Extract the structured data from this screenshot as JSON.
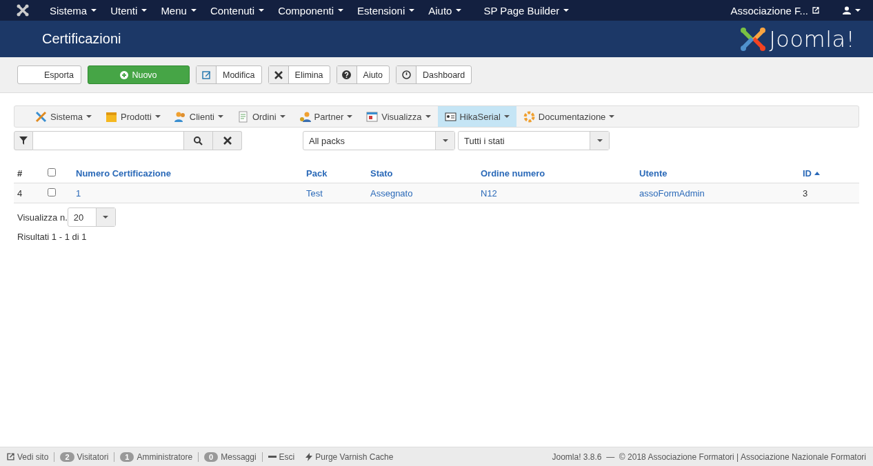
{
  "top_menu": {
    "items": [
      {
        "label": "Sistema"
      },
      {
        "label": "Utenti"
      },
      {
        "label": "Menu"
      },
      {
        "label": "Contenuti"
      },
      {
        "label": "Componenti"
      },
      {
        "label": "Estensioni"
      },
      {
        "label": "Aiuto"
      },
      {
        "label": "SP Page Builder"
      }
    ],
    "site_link": "Associazione F..."
  },
  "header": {
    "title": "Certificazioni",
    "logo_text": "Joomla!"
  },
  "toolbar": {
    "buttons": [
      {
        "label": "Esporta",
        "kind": "export"
      },
      {
        "label": "Nuovo",
        "kind": "new"
      },
      {
        "label": "Modifica",
        "kind": "edit"
      },
      {
        "label": "Elimina",
        "kind": "delete"
      },
      {
        "label": "Aiuto",
        "kind": "help"
      },
      {
        "label": "Dashboard",
        "kind": "dashboard"
      }
    ]
  },
  "submenu": {
    "items": [
      {
        "label": "Sistema",
        "selected": false
      },
      {
        "label": "Prodotti",
        "selected": false
      },
      {
        "label": "Clienti",
        "selected": false
      },
      {
        "label": "Ordini",
        "selected": false
      },
      {
        "label": "Partner",
        "selected": false
      },
      {
        "label": "Visualizza",
        "selected": false
      },
      {
        "label": "HikaSerial",
        "selected": true
      },
      {
        "label": "Documentazione",
        "selected": false
      }
    ]
  },
  "filters": {
    "selects": [
      "All packs",
      "Tutti i stati"
    ]
  },
  "table": {
    "columns": [
      {
        "label": "#",
        "kind": "text",
        "sorted": false
      },
      {
        "kind": "check",
        "checked": false
      },
      {
        "label": "Numero Certificazione",
        "kind": "link",
        "sorted": false
      },
      {
        "label": "Pack",
        "kind": "link",
        "sorted": false
      },
      {
        "label": "Stato",
        "kind": "link",
        "sorted": false
      },
      {
        "label": "Ordine numero",
        "kind": "link",
        "sorted": false
      },
      {
        "label": "Utente",
        "kind": "link",
        "sorted": false
      },
      {
        "label": "ID",
        "kind": "link",
        "sorted": true
      }
    ],
    "rows": [
      {
        "checked": false,
        "cells": [
          "4",
          "",
          "1",
          "Test",
          "Assegnato",
          "N12",
          "assoFormAdmin",
          "3"
        ]
      }
    ]
  },
  "pagination": {
    "label": "Visualizza n.",
    "value": "20",
    "results": "Risultati 1 - 1 di 1"
  },
  "status_bar": {
    "items": [
      {
        "kind": "link",
        "label": "Vedi sito"
      },
      {
        "kind": "count",
        "count": "2",
        "label": "Visitatori"
      },
      {
        "kind": "count",
        "count": "1",
        "label": "Amministratore"
      },
      {
        "kind": "count",
        "count": "0",
        "label": "Messaggi"
      },
      {
        "kind": "logout",
        "label": "Esci"
      },
      {
        "kind": "bolt",
        "label": "Purge Varnish Cache"
      }
    ],
    "right": "Joomla! 3.8.6  —  © 2018 Associazione Formatori | Associazione Nazionale Formatori"
  }
}
